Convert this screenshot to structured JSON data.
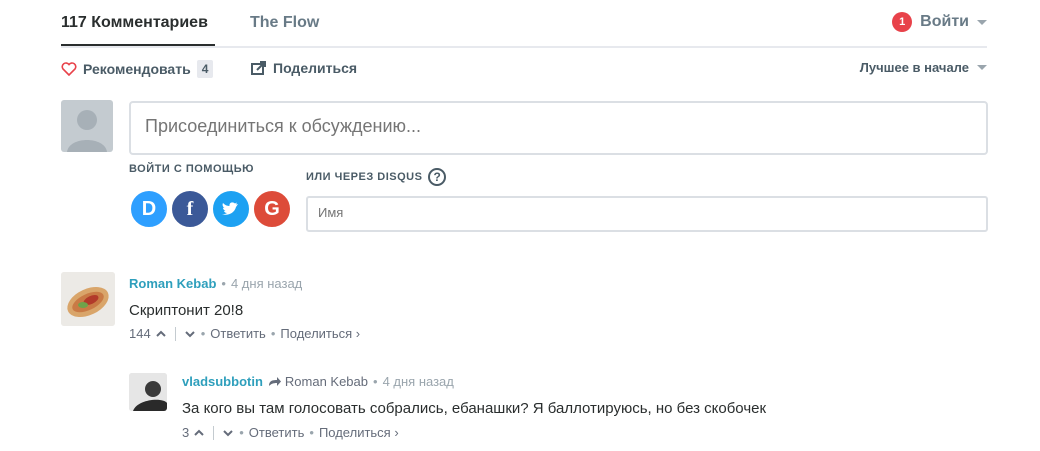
{
  "nav": {
    "tab_comments": "117 Комментариев",
    "tab_flow": "The Flow",
    "notification_count": "1",
    "login_label": "Войти"
  },
  "actions": {
    "recommend_label": "Рекомендовать",
    "recommend_count": "4",
    "share_label": "Поделиться",
    "sort_label": "Лучшее в начале"
  },
  "composer": {
    "placeholder": "Присоединиться к обсуждению...",
    "login_with_label": "ВОЙТИ С ПОМОЩЬЮ",
    "or_disqus_label": "ИЛИ ЧЕРЕЗ DISQUS",
    "help_glyph": "?",
    "name_placeholder": "Имя",
    "social": [
      {
        "letter": "D",
        "color": "#2e9fff",
        "icon": "disqus-icon"
      },
      {
        "letter": "f",
        "color": "#3b5998",
        "icon": "facebook-icon"
      },
      {
        "letter": "t",
        "color": "#1da1f2",
        "icon": "twitter-icon"
      },
      {
        "letter": "G",
        "color": "#dd4b39",
        "icon": "google-icon"
      }
    ]
  },
  "comments": [
    {
      "author": "Roman Kebab",
      "time": "4 дня назад",
      "text": "Скриптонит 20!8",
      "votes": "144",
      "reply_label": "Ответить",
      "share_label": "Поделиться ›"
    },
    {
      "author": "vladsubbotin",
      "reply_to": "Roman Kebab",
      "time": "4 дня назад",
      "text": "За кого вы там голосовать собрались, ебанашки? Я баллотируюсь, но без скобочек",
      "votes": "3",
      "reply_label": "Ответить",
      "share_label": "Поделиться ›"
    }
  ],
  "colors": {
    "accent_link": "#2e9fbc",
    "notification": "#e8424a",
    "text_dark": "#2a2e2e",
    "text_muted": "#687a86"
  }
}
